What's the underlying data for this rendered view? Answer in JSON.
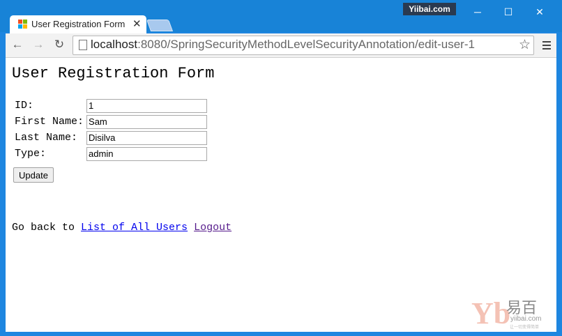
{
  "window": {
    "watermark_top": "Yiibai.com",
    "minimize_glyph": "─",
    "maximize_glyph": "☐",
    "close_glyph": "✕"
  },
  "tab": {
    "title": "User Registration Form",
    "close_glyph": "✕"
  },
  "toolbar": {
    "back_glyph": "←",
    "forward_glyph": "→",
    "reload_glyph": "↻",
    "url_host": "localhost",
    "url_rest": ":8080/SpringSecurityMethodLevelSecurityAnnotation/edit-user-1",
    "star_glyph": "☆"
  },
  "page": {
    "heading": "User Registration Form",
    "fields": [
      {
        "label": "ID:",
        "value": "1"
      },
      {
        "label": "First Name:",
        "value": "Sam"
      },
      {
        "label": "Last Name:",
        "value": "Disilva"
      },
      {
        "label": "Type:",
        "value": "admin"
      }
    ],
    "update_label": "Update",
    "footer_text": "Go back to",
    "list_link": "List of All Users",
    "logout_link": "Logout"
  },
  "watermark": {
    "mark": "Yb",
    "cn": "易百",
    "en": "yiibai.com",
    "tag": "让一切变得简单"
  },
  "colors": {
    "titlebar": "#1883d7",
    "link": "#0000ee",
    "visited_link": "#551a8b"
  }
}
